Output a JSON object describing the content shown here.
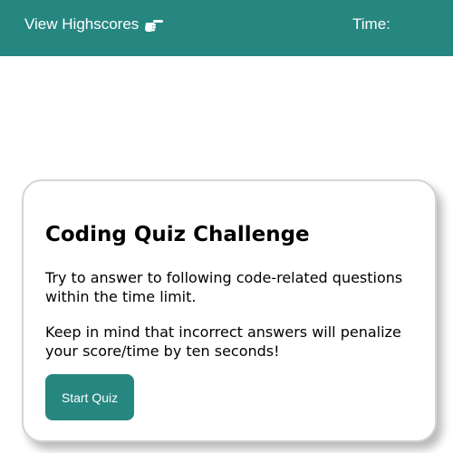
{
  "header": {
    "highscores_label": "View Highscores",
    "highscores_icon": "pointing-hand-icon",
    "timer_label": "Time:",
    "timer_value": "",
    "background_color": "#268680"
  },
  "card": {
    "title": "Coding Quiz Challenge",
    "line1": "Try to answer to following code-related questions within the time limit.",
    "line2": "Keep in mind that incorrect answers will penalize your score/time by ten seconds!",
    "start_button_label": "Start Quiz",
    "button_color": "#268680"
  }
}
